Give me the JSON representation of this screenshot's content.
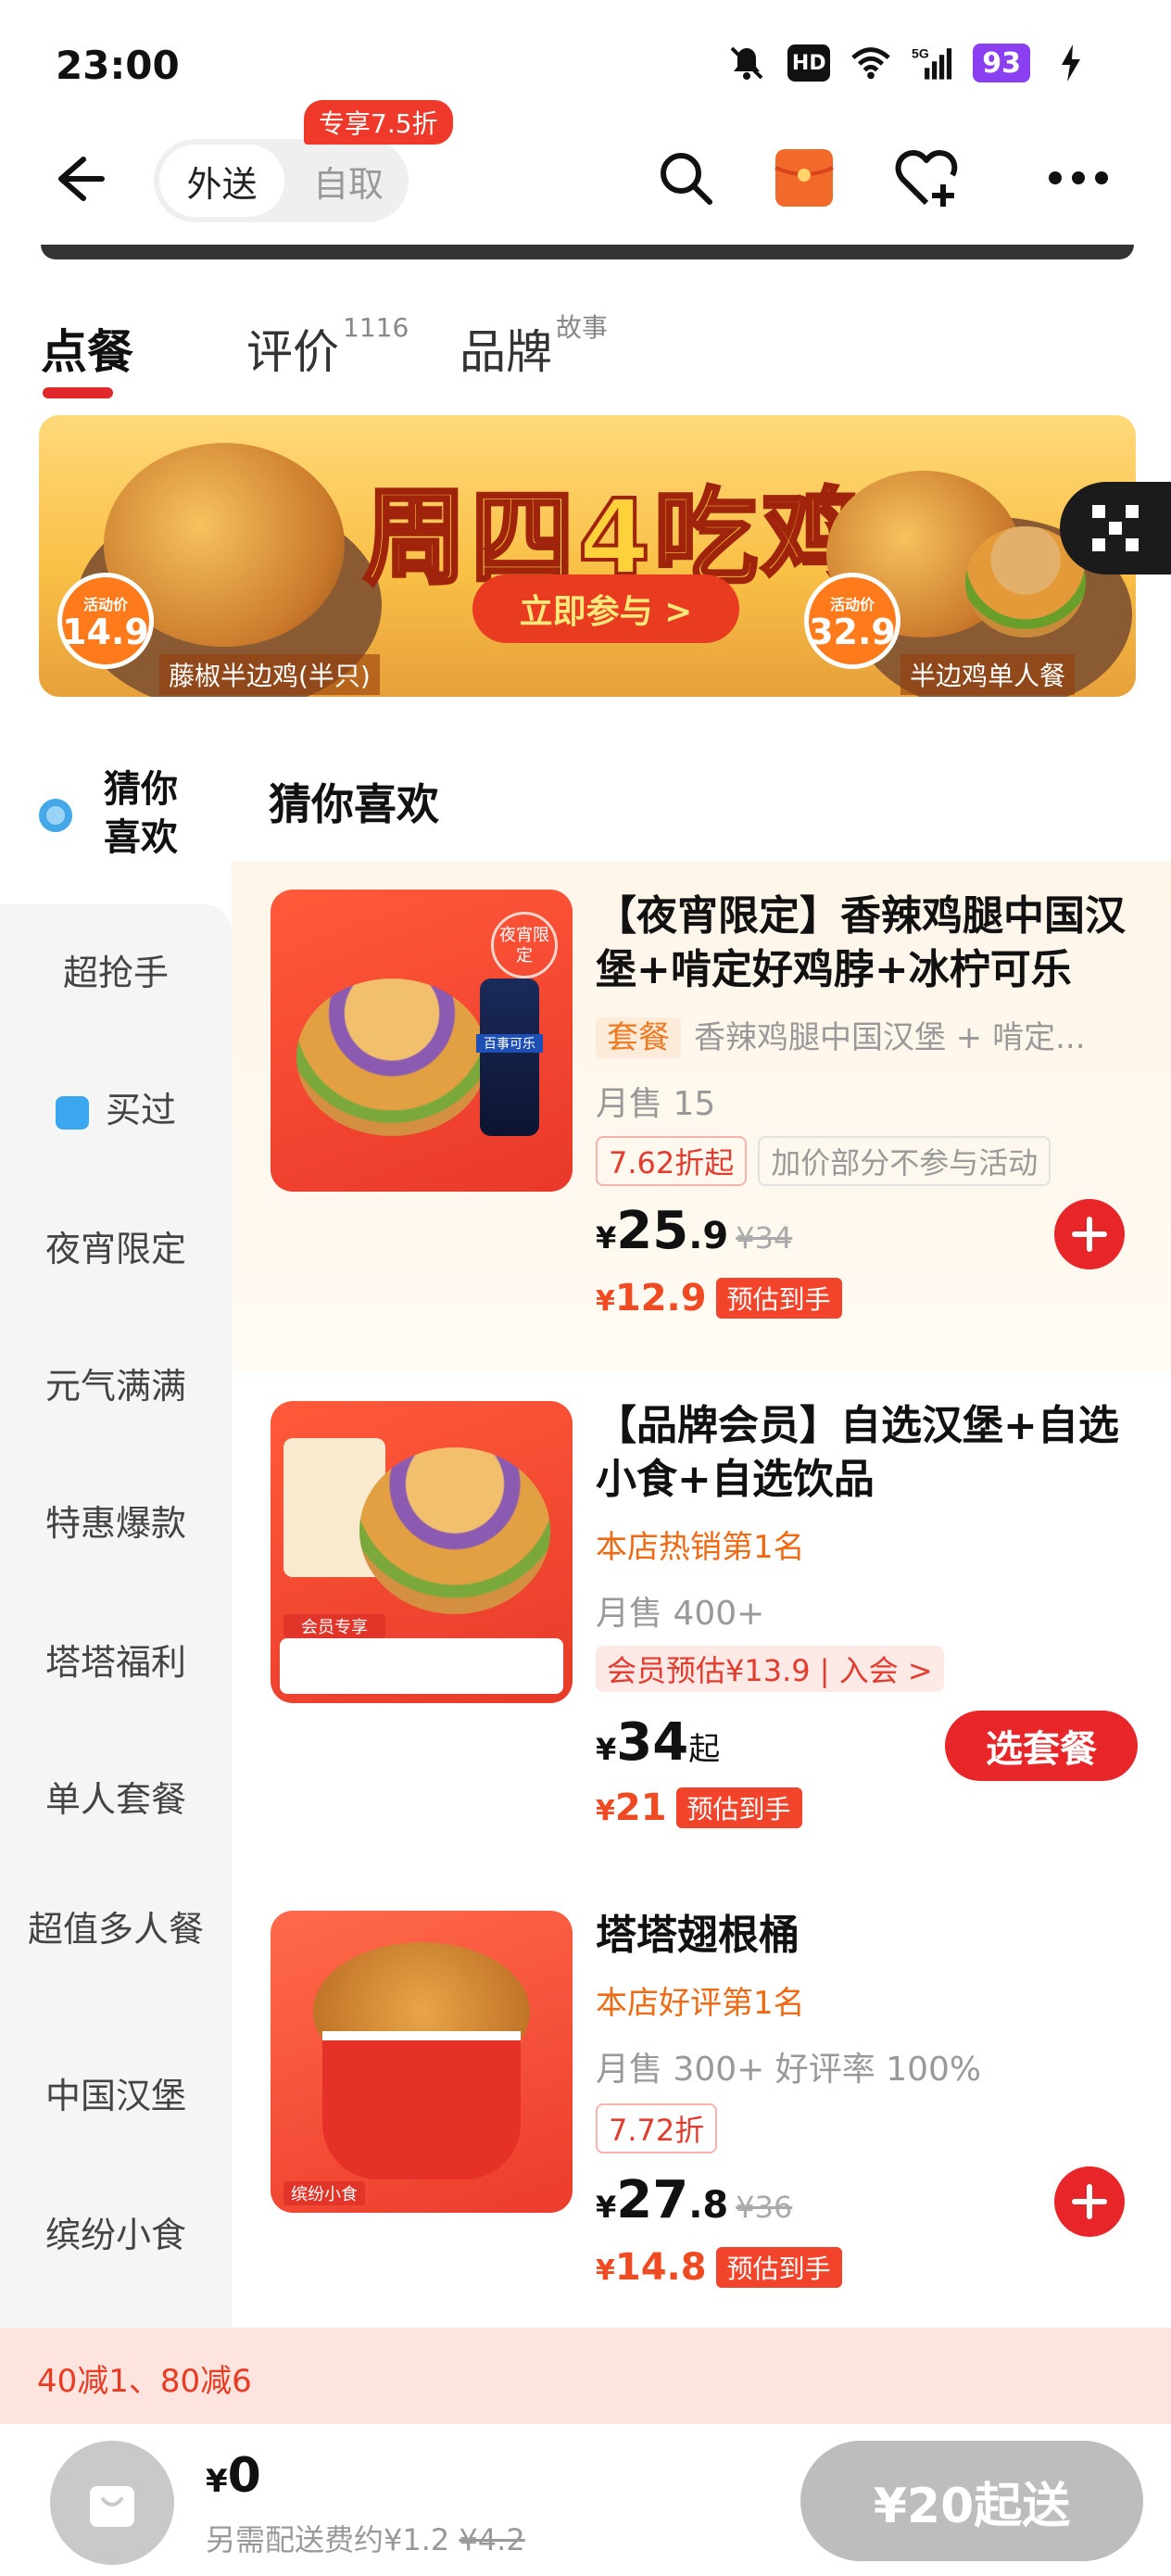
{
  "status_bar": {
    "time": "23:00",
    "hd": "HD",
    "network": "5G",
    "battery": "93"
  },
  "nav": {
    "mode_active": "外送",
    "mode_inactive": "自取",
    "promo_badge": "专享7.5折"
  },
  "tabs": [
    {
      "label": "点餐",
      "sup": ""
    },
    {
      "label": "评价",
      "sup": "1116"
    },
    {
      "label": "品牌",
      "sup": "故事"
    }
  ],
  "banner": {
    "title": "周四4吃鸡",
    "cta": "立即参与 >",
    "left_price_label": "活动价",
    "left_price": "14.9",
    "left_item": "藤椒半边鸡(半只)",
    "right_price_label": "活动价",
    "right_price": "32.9",
    "right_item": "半边鸡单人餐"
  },
  "sidebar": {
    "header": "猜你喜欢",
    "items": [
      "超抢手",
      "买过",
      "夜宵限定",
      "元气满满",
      "特惠爆款",
      "塔塔福利",
      "单人套餐",
      "超值多人餐",
      "中国汉堡",
      "缤纷小食"
    ]
  },
  "section_title": "猜你喜欢",
  "products": [
    {
      "name": "【夜宵限定】香辣鸡腿中国汉堡+啃定好鸡脖+冰柠可乐",
      "combo_tag": "套餐",
      "desc": "香辣鸡腿中国汉堡 + 啃定...",
      "sales": "月售 15",
      "chips": [
        "7.62折起",
        "加价部分不参与活动"
      ],
      "currency": "¥",
      "price_int": "25",
      "price_dec": ".9",
      "price_suffix": "",
      "orig_price": "¥34",
      "est_price": "12.9",
      "est_label": "预估到手",
      "img_badge": "夜宵限定",
      "cup_label": "百事可乐"
    },
    {
      "name": "【品牌会员】自选汉堡+自选小食+自选饮品",
      "rank_tag": "本店热销第1名",
      "sales": "月售 400+",
      "vip_chip": "会员预估¥13.9 | 入会 >",
      "currency": "¥",
      "price_int": "34",
      "price_dec": "",
      "price_suffix": "起",
      "orig_price": "",
      "est_price": "21",
      "est_label": "预估到手",
      "action": "选套餐",
      "img_badge": "会员专享"
    },
    {
      "name": "塔塔翅根桶",
      "rank_tag": "本店好评第1名",
      "sales": "月售 300+ 好评率 100%",
      "chips": [
        "7.72折"
      ],
      "currency": "¥",
      "price_int": "27",
      "price_dec": ".8",
      "price_suffix": "",
      "orig_price": "¥36",
      "est_price": "14.8",
      "est_label": "预估到手",
      "img_badge": "缤纷小食"
    }
  ],
  "promo_strip": "40减1、80减6",
  "bottom": {
    "currency": "¥",
    "total": "0",
    "fee_text": "另需配送费约¥1.2",
    "fee_orig": "¥4.2",
    "min_order": "¥20起送"
  },
  "colors": {
    "accent": "#e8262a",
    "promo": "#ef3a2b",
    "highlight_bg": "#fff6ea"
  }
}
